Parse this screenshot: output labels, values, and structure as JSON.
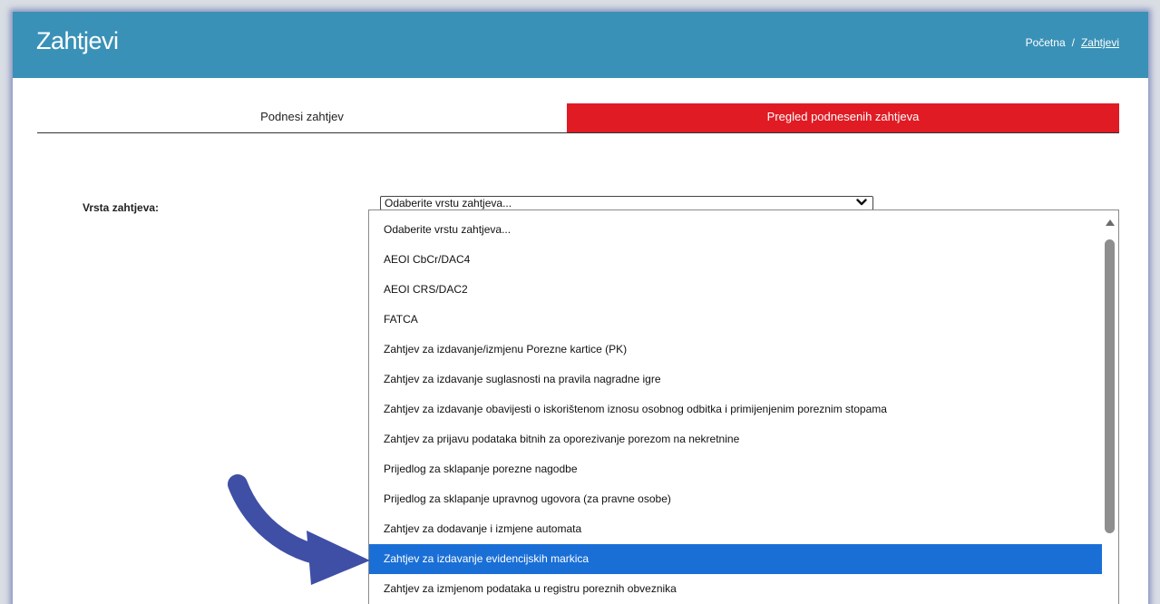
{
  "header": {
    "title": "Zahtjevi",
    "breadcrumb": {
      "home": "Početna",
      "separator": "/",
      "current": "Zahtjevi"
    },
    "color": "#3a91b7"
  },
  "tabs": [
    {
      "label": "Podnesi zahtjev",
      "active": false
    },
    {
      "label": "Pregled podnesenih zahtjeva",
      "active": true
    }
  ],
  "form": {
    "request_type_label": "Vrsta zahtjeva:",
    "select_value": "Odaberite vrstu zahtjeva...",
    "options": [
      "Odaberite vrstu zahtjeva...",
      "AEOI CbCr/DAC4",
      "AEOI CRS/DAC2",
      "FATCA",
      "Zahtjev za izdavanje/izmjenu Porezne kartice (PK)",
      "Zahtjev za izdavanje suglasnosti na pravila nagradne igre",
      "Zahtjev za izdavanje obavijesti o iskorištenom iznosu osobnog odbitka i primijenjenim poreznim stopama",
      "Zahtjev za prijavu podataka bitnih za oporezivanje porezom na nekretnine",
      "Prijedlog za sklapanje porezne nagodbe",
      "Prijedlog za sklapanje upravnog ugovora (za pravne osobe)",
      "Zahtjev za dodavanje i izmjene automata",
      "Zahtjev za izdavanje evidencijskih markica",
      "Zahtjev za izmjenom podataka u registru poreznih obveznika"
    ],
    "highlighted_option": "Zahtjev za izdavanje evidencijskih markica"
  },
  "colors": {
    "active_tab": "#e01b24",
    "selected_option": "#1a6fd6",
    "annotation_arrow": "#3f4fa6"
  },
  "icons": {
    "select_chevron": "chevron-down-icon",
    "scroll_up": "scroll-up-icon",
    "annotation": "arrow-pointer-icon"
  }
}
